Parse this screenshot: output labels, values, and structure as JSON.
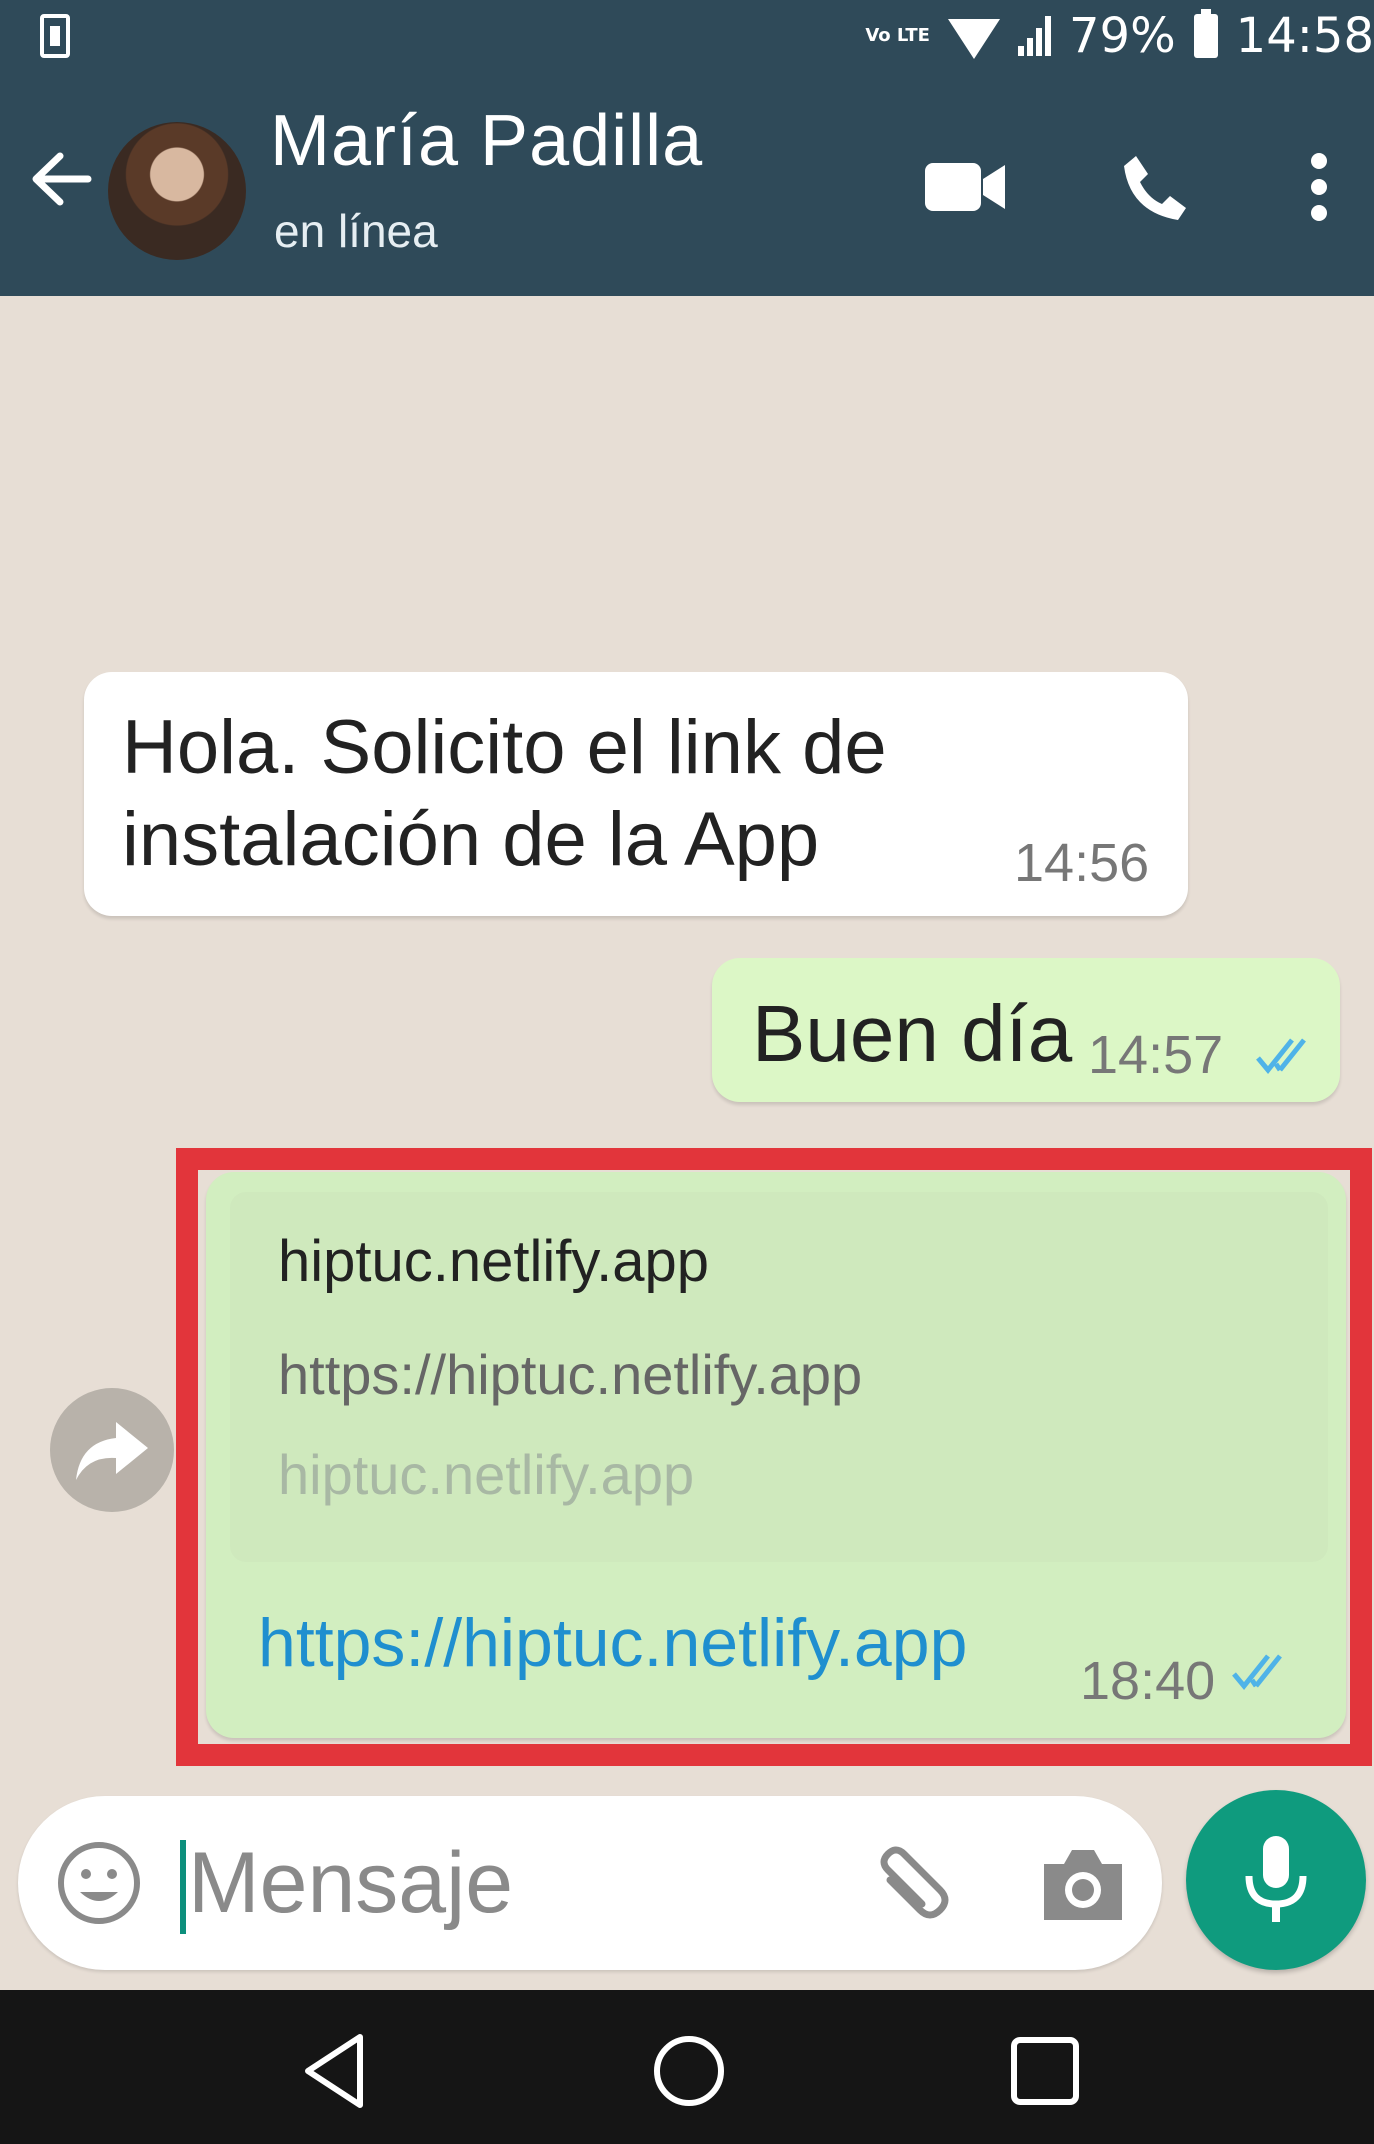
{
  "status_bar": {
    "network_label": "Vo LTE",
    "battery": "79%",
    "time": "14:58"
  },
  "header": {
    "contact_name": "María Padilla",
    "contact_status": "en línea"
  },
  "messages": [
    {
      "direction": "in",
      "text_line1": "Hola. Solicito el link de",
      "text_line2": "instalación de la App",
      "time": "14:56"
    },
    {
      "direction": "out",
      "text": "Buen día",
      "time": "14:57"
    },
    {
      "direction": "out",
      "preview_title": "hiptuc.netlify.app",
      "preview_description": "https://hiptuc.netlify.app",
      "preview_domain": "hiptuc.netlify.app",
      "link": "https://hiptuc.netlify.app",
      "time": "18:40"
    }
  ],
  "composer": {
    "placeholder": "Mensaje"
  },
  "colors": {
    "header": "#2f4a59",
    "chat_background": "#e7ded5",
    "outgoing_bubble": "#dcf7c6",
    "accent_green": "#0f9b7e",
    "highlight_red": "#e2353b",
    "link_blue": "#1f8fcf",
    "read_tick_blue": "#4fb3e8"
  },
  "icons": {
    "back": "arrow-left-icon",
    "video": "video-camera-icon",
    "call": "phone-icon",
    "menu": "more-vertical-icon",
    "forward": "forward-icon",
    "emoji": "smiley-icon",
    "attach": "paperclip-icon",
    "camera": "camera-icon",
    "mic": "microphone-icon"
  }
}
